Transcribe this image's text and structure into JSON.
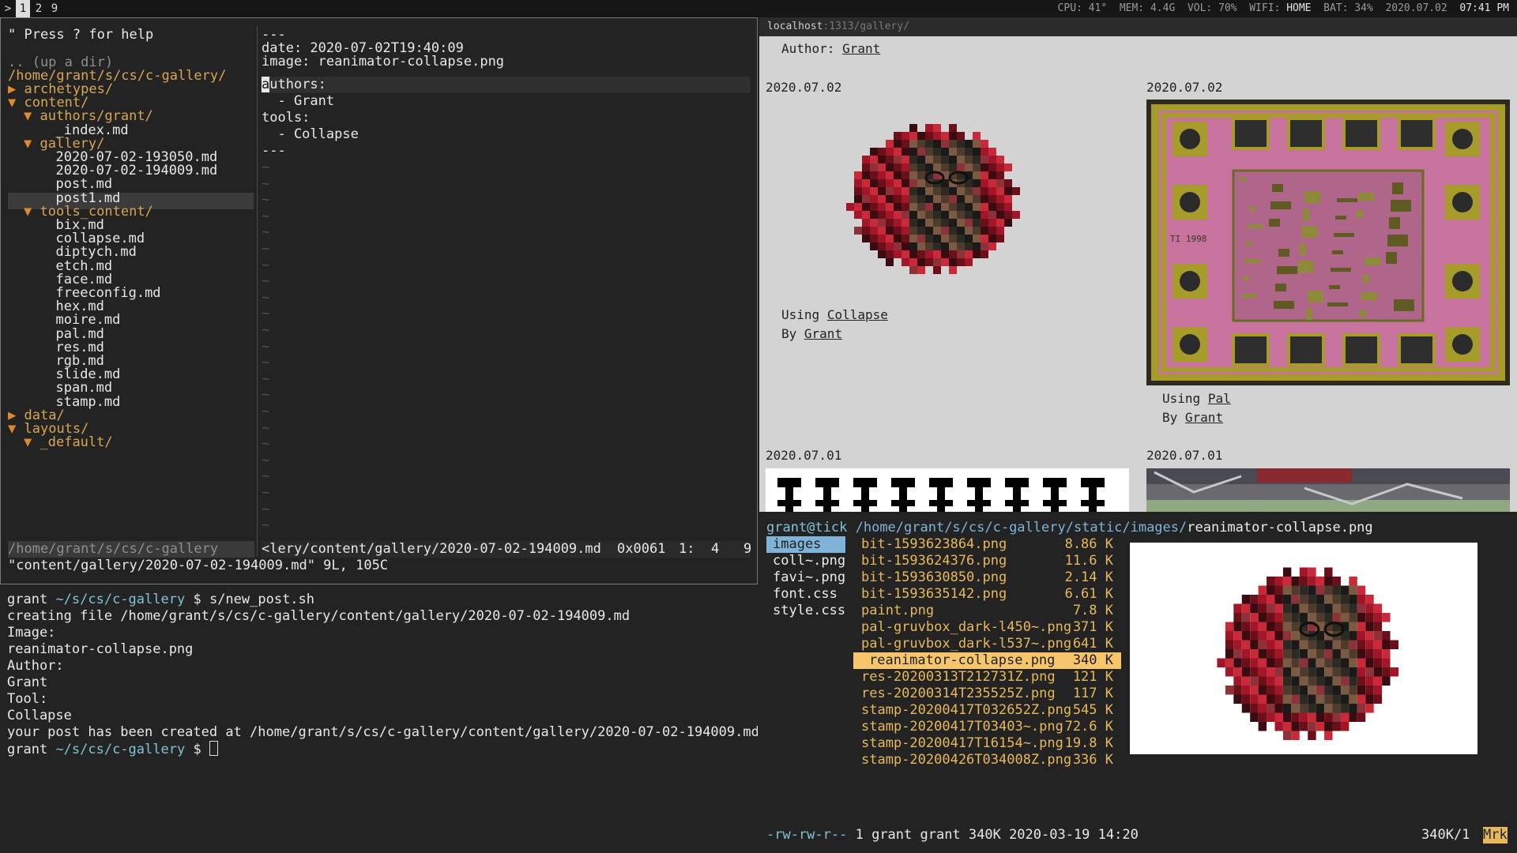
{
  "topbar": {
    "prompt_glyph": ">",
    "workspaces": [
      "1",
      "2",
      "9"
    ],
    "active_workspace": "1",
    "cpu": "CPU: 41°",
    "mem": "MEM: 4.4G",
    "vol": "VOL: 70%",
    "wifi_label": "WIFI:",
    "wifi_value": "HOME",
    "bat": "BAT: 34%",
    "date": "2020.07.02",
    "time": "07:41 PM"
  },
  "vim": {
    "tree": {
      "help": "\" Press ? for help",
      "updir": ".. (up a dir)",
      "root": "/home/grant/s/cs/c-gallery/",
      "items": [
        {
          "arrow": "▶",
          "label": "archetypes/",
          "kind": "dir"
        },
        {
          "arrow": "▼",
          "label": "content/",
          "kind": "dir"
        },
        {
          "arrow": "▼",
          "label": "authors/grant/",
          "kind": "dir"
        },
        {
          "arrow": "",
          "label": "_index.md",
          "kind": "file"
        },
        {
          "arrow": "▼",
          "label": "gallery/",
          "kind": "dir"
        },
        {
          "arrow": "",
          "label": "2020-07-02-193050.md",
          "kind": "file"
        },
        {
          "arrow": "",
          "label": "2020-07-02-194009.md",
          "kind": "file"
        },
        {
          "arrow": "",
          "label": "post.md",
          "kind": "file"
        },
        {
          "arrow": "",
          "label": "post1.md",
          "kind": "file"
        },
        {
          "arrow": "▼",
          "label": "tools_content/",
          "kind": "dir"
        },
        {
          "arrow": "",
          "label": "bix.md",
          "kind": "file"
        },
        {
          "arrow": "",
          "label": "collapse.md",
          "kind": "file"
        },
        {
          "arrow": "",
          "label": "diptych.md",
          "kind": "file"
        },
        {
          "arrow": "",
          "label": "etch.md",
          "kind": "file"
        },
        {
          "arrow": "",
          "label": "face.md",
          "kind": "file"
        },
        {
          "arrow": "",
          "label": "freeconfig.md",
          "kind": "file"
        },
        {
          "arrow": "",
          "label": "hex.md",
          "kind": "file"
        },
        {
          "arrow": "",
          "label": "moire.md",
          "kind": "file"
        },
        {
          "arrow": "",
          "label": "pal.md",
          "kind": "file"
        },
        {
          "arrow": "",
          "label": "res.md",
          "kind": "file"
        },
        {
          "arrow": "",
          "label": "rgb.md",
          "kind": "file"
        },
        {
          "arrow": "",
          "label": "slide.md",
          "kind": "file"
        },
        {
          "arrow": "",
          "label": "span.md",
          "kind": "file"
        },
        {
          "arrow": "",
          "label": "stamp.md",
          "kind": "file"
        },
        {
          "arrow": "▶",
          "label": "data/",
          "kind": "dir"
        },
        {
          "arrow": "▼",
          "label": "layouts/",
          "kind": "dir"
        },
        {
          "arrow": "▼",
          "label": "_default/",
          "kind": "dir"
        }
      ],
      "status": "/home/grant/s/cs/c-gallery"
    },
    "editor": {
      "lines": [
        "---",
        "date: 2020-07-02T19:40:09",
        "image: reanimator-collapse.png",
        "uthors:",
        "  - Grant",
        "tools:",
        "  - Collapse",
        "---"
      ],
      "cursor_char": "a",
      "tilde": "~",
      "status_path": "<lery/content/gallery/2020-07-02-194009.md",
      "status_hex": "0x0061",
      "status_pos": "1:  4",
      "status_pct": "9"
    },
    "message": "\"content/gallery/2020-07-02-194009.md\" 9L, 105C"
  },
  "shell": {
    "user": "grant",
    "cwd": "~/s/cs/c-gallery",
    "sigil": "$",
    "command": "s/new_post.sh",
    "output": [
      "creating file /home/grant/s/cs/c-gallery/content/gallery/2020-07-02-194009.md",
      "Image:",
      "reanimator-collapse.png",
      "Author:",
      "Grant",
      "Tool:",
      "Collapse",
      "your post has been created at /home/grant/s/cs/c-gallery/content/gallery/2020-07-02-194009.md"
    ]
  },
  "browser": {
    "url_host": "localhost",
    "url_rest": ":1313/gallery/",
    "author_label": "Author:",
    "author_name": "Grant",
    "cards": [
      {
        "date": "2020.07.02",
        "using": "Using",
        "tool": "Collapse",
        "by": "By",
        "author": "Grant"
      },
      {
        "date": "2020.07.02",
        "using": "Using",
        "tool": "Pal",
        "by": "By",
        "author": "Grant"
      },
      {
        "date": "2020.07.01"
      },
      {
        "date": "2020.07.01"
      }
    ],
    "chip_text": "TI 1998"
  },
  "ranger": {
    "host": "grant@tick",
    "path": "/home/grant/s/cs/c-gallery/static/images/",
    "file": "reanimator-collapse.png",
    "parent_items": [
      "images",
      "coll~.png",
      "favi~.png",
      "font.css",
      "style.css"
    ],
    "files": [
      {
        "name": "bit-1593623864.png",
        "size": "8.86 K"
      },
      {
        "name": "bit-1593624376.png",
        "size": "11.6 K"
      },
      {
        "name": "bit-1593630850.png",
        "size": "2.14 K"
      },
      {
        "name": "bit-1593635142.png",
        "size": "6.61 K"
      },
      {
        "name": "paint.png",
        "size": "7.8 K"
      },
      {
        "name": "pal-gruvbox_dark-l450~.png",
        "size": "371 K"
      },
      {
        "name": "pal-gruvbox_dark-l537~.png",
        "size": "641 K"
      },
      {
        "name": "reanimator-collapse.png",
        "size": "340 K"
      },
      {
        "name": "res-20200313T212731Z.png",
        "size": "121 K"
      },
      {
        "name": "res-20200314T235525Z.png",
        "size": "117 K"
      },
      {
        "name": "stamp-20200417T032652Z.png",
        "size": "545 K"
      },
      {
        "name": "stamp-20200417T03403~.png",
        "size": "72.6 K"
      },
      {
        "name": "stamp-20200417T16154~.png",
        "size": "19.8 K"
      },
      {
        "name": "stamp-20200426T034008Z.png",
        "size": "336 K"
      }
    ],
    "selected_index": 7,
    "status_perms": "-rw-rw-r--",
    "status_info": "1 grant grant 340K 2020-03-19 14:20",
    "status_count": "340K/1",
    "status_mark": "Mrk"
  },
  "colors": {
    "dir": "#d7a657",
    "arrow": "#e08a2b",
    "cyan": "#7fc3d6",
    "ranger_gold": "#e7b95c",
    "selection_gold": "#f7c66a",
    "parent_select": "#7fb4d8"
  }
}
